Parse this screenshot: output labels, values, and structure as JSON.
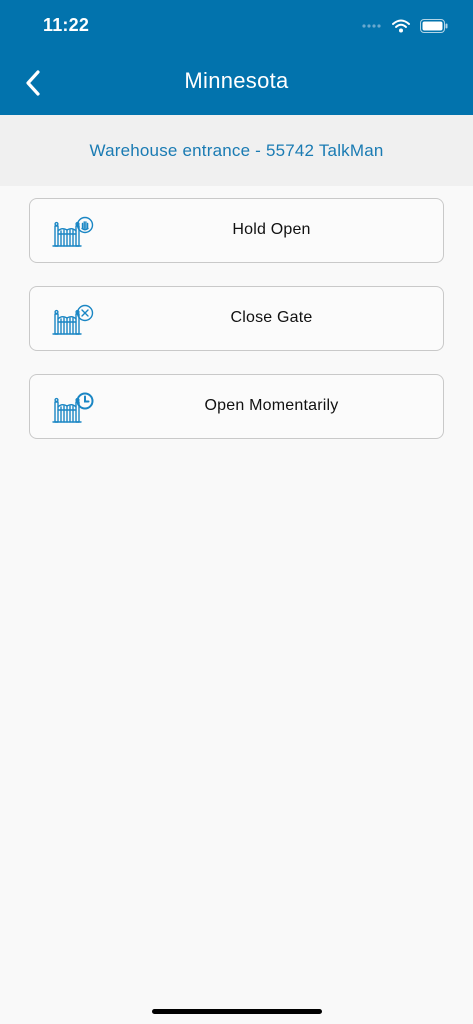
{
  "status_bar": {
    "time": "11:22"
  },
  "header": {
    "title": "Minnesota",
    "back_icon": "chevron-left-icon"
  },
  "subheader": {
    "text": "Warehouse entrance - 55742 TalkMan"
  },
  "actions": [
    {
      "label": "Hold Open",
      "icon": "gate-hold-icon"
    },
    {
      "label": "Close Gate",
      "icon": "gate-close-icon"
    },
    {
      "label": "Open Momentarily",
      "icon": "gate-timer-icon"
    }
  ],
  "colors": {
    "brand": "#0273ad",
    "subtitle": "#1a7bb3",
    "icon": "#1a86c4",
    "background": "#f9f9f9"
  }
}
